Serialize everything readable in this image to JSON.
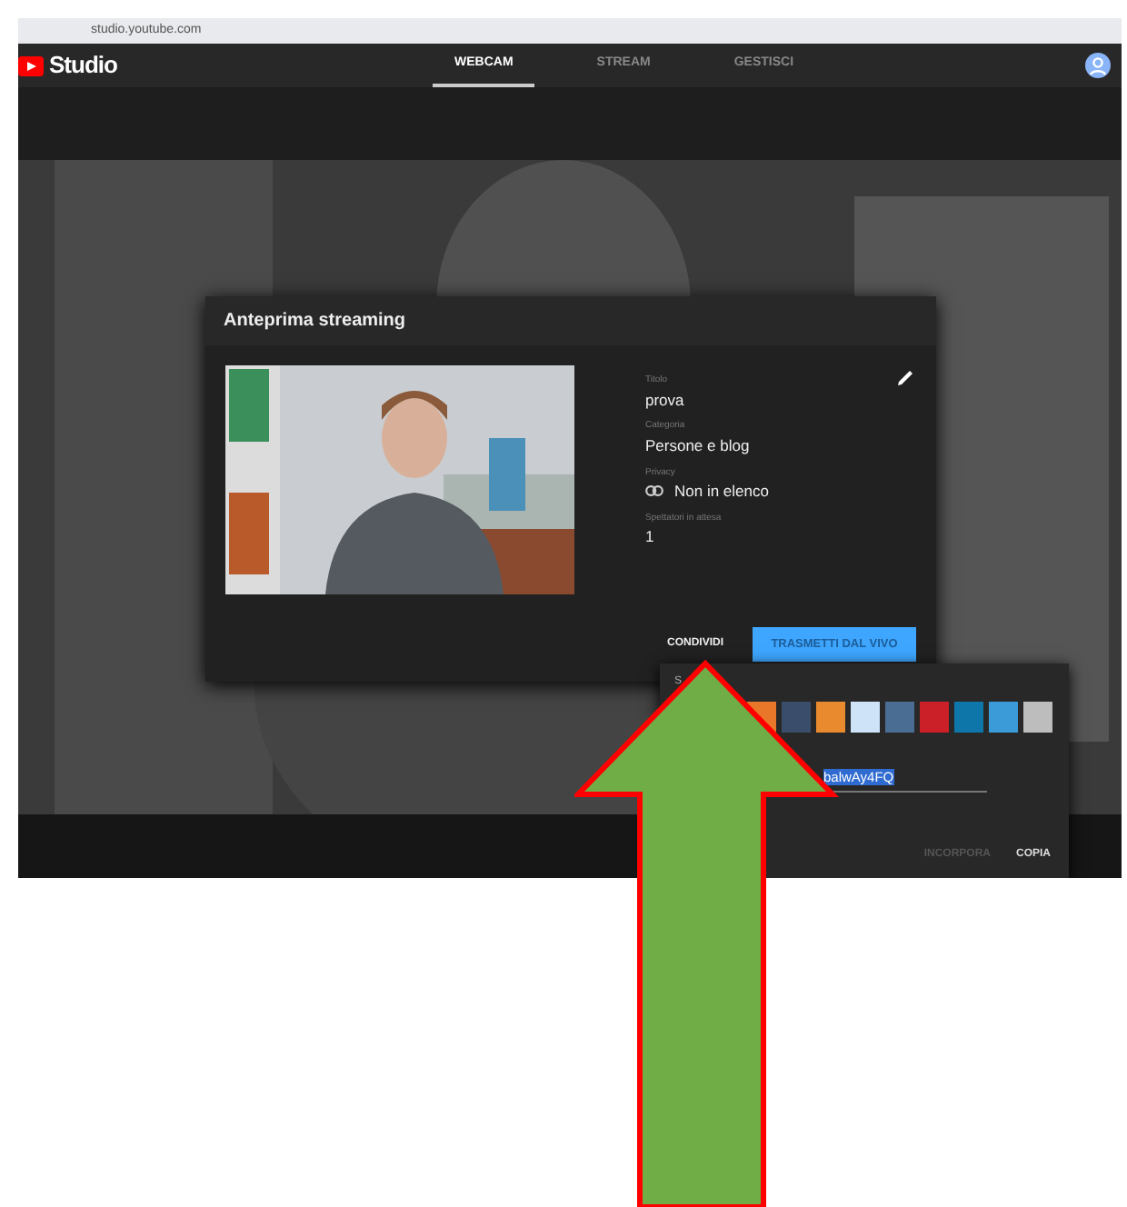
{
  "browser": {
    "url": "studio.youtube.com"
  },
  "header": {
    "logo": "Studio",
    "tabs": [
      {
        "label": "WEBCAM",
        "selected": true
      },
      {
        "label": "STREAM",
        "selected": false
      },
      {
        "label": "GESTISCI",
        "selected": false
      }
    ]
  },
  "dialog": {
    "title": "Anteprima streaming",
    "fields": [
      {
        "label": "Titolo",
        "value": "prova",
        "kind": "editable"
      },
      {
        "label": "Categoria",
        "value": "Persone e blog",
        "kind": "plain"
      },
      {
        "label": "Privacy",
        "value": "Non in elenco",
        "kind": "link"
      },
      {
        "label": "Spettatori in attesa",
        "value": "1",
        "kind": "plain"
      }
    ],
    "buttons": [
      {
        "label": "CONDIVIDI",
        "kind": "text"
      },
      {
        "label": "TRASMETTI DAL VIVO",
        "kind": "primary"
      }
    ]
  },
  "share": {
    "label": "S",
    "services": [
      {
        "color": "#e8772a"
      },
      {
        "color": "#3a4e6b"
      },
      {
        "color": "#ea8a2f"
      },
      {
        "color": "#cee3f8"
      },
      {
        "color": "#4a6d94"
      },
      {
        "color": "#cb2027"
      },
      {
        "color": "#0e76a8"
      },
      {
        "color": "#3a9bd8"
      },
      {
        "color": "#bdbdbd"
      }
    ],
    "link": {
      "text": "balwAy4FQ",
      "highlighted": true
    },
    "actions": [
      {
        "label": "INCORPORA",
        "disabled": true
      },
      {
        "label": "COPIA",
        "disabled": false
      }
    ]
  },
  "annotation": {
    "kind": "arrow"
  }
}
